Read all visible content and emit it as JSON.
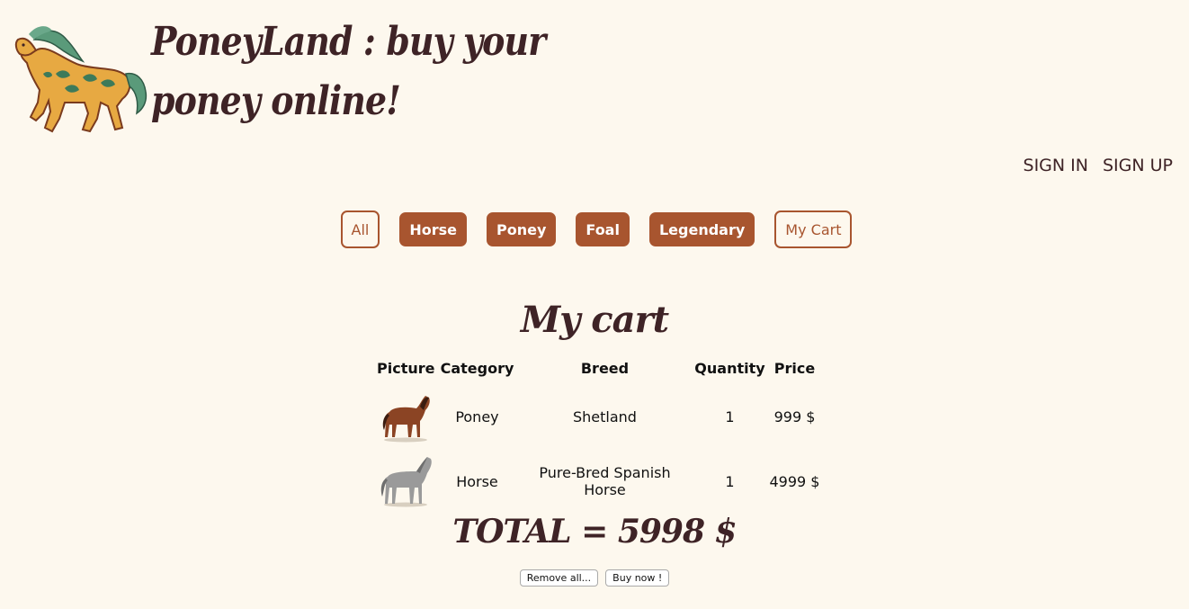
{
  "header": {
    "title": "PoneyLand : buy your poney online!",
    "logo_icon": "horse-logo-icon"
  },
  "auth": {
    "sign_in": "SIGN IN",
    "sign_up": "SIGN UP"
  },
  "nav": {
    "items": [
      {
        "label": "All",
        "style": "outline"
      },
      {
        "label": "Horse",
        "style": "filled"
      },
      {
        "label": "Poney",
        "style": "filled"
      },
      {
        "label": "Foal",
        "style": "filled"
      },
      {
        "label": "Legendary",
        "style": "filled"
      },
      {
        "label": "My Cart",
        "style": "outline"
      }
    ]
  },
  "cart": {
    "title": "My cart",
    "columns": [
      "Picture",
      "Category",
      "Breed",
      "Quantity",
      "Price"
    ],
    "rows": [
      {
        "picture_icon": "brown-pony-icon",
        "category": "Poney",
        "breed": "Shetland",
        "quantity": "1",
        "price": "999 $"
      },
      {
        "picture_icon": "grey-horse-icon",
        "category": "Horse",
        "breed": "Pure-Bred Spanish Horse",
        "quantity": "1",
        "price": "4999 $"
      }
    ],
    "total": "TOTAL = 5998 $",
    "remove_all_label": "Remove all...",
    "buy_now_label": "Buy now !"
  },
  "colors": {
    "background": "#fdf8ee",
    "accent": "#a8552f",
    "title_text": "#3e2326"
  }
}
